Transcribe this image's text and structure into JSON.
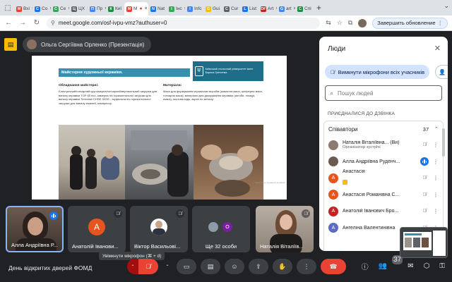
{
  "browser": {
    "tabs": [
      {
        "label": "Вхі",
        "fav_color": "#ea4335",
        "fav_text": "M"
      },
      {
        "label": "Co",
        "fav_color": "#1a73e8",
        "fav_text": "C"
      },
      {
        "label": "Се",
        "fav_color": "#34a853",
        "fav_text": "С"
      },
      {
        "label": "ЦХ",
        "fav_color": "#5f6368",
        "fav_text": "Ц"
      },
      {
        "label": "Пр",
        "fav_color": "#4285f4",
        "fav_text": "П"
      },
      {
        "label": "Киї",
        "fav_color": "#1e8e3e",
        "fav_text": "К"
      },
      {
        "label": "М",
        "fav_color": "#ea4335",
        "fav_text": "M",
        "active": true
      },
      {
        "label": "Nat",
        "fav_color": "#1a73e8",
        "fav_text": "N"
      },
      {
        "label": "Інс",
        "fav_color": "#34a853",
        "fav_text": "І"
      },
      {
        "label": "Infc",
        "fav_color": "#4285f4",
        "fav_text": "I"
      },
      {
        "label": "Gui",
        "fav_color": "#fbbc04",
        "fav_text": "G"
      },
      {
        "label": "Cur",
        "fav_color": "#5f6368",
        "fav_text": "C"
      },
      {
        "label": "List",
        "fav_color": "#1a73e8",
        "fav_text": "L"
      },
      {
        "label": "Art",
        "fav_color": "#c5221f",
        "fav_text": "DF"
      },
      {
        "label": "art",
        "fav_color": "#4285f4",
        "fav_text": "G"
      },
      {
        "label": "Спі",
        "fav_color": "#1e8e3e",
        "fav_text": "С"
      }
    ],
    "url": "meet.google.com/osf-ivpu-vmz?authuser=0",
    "update_label": "Завершить обновление"
  },
  "presenter": {
    "label": "Ольга Сергіївна Орленко (Презентація)"
  },
  "slide": {
    "title": "Майстерня художньої кераміки.",
    "university": "Київський столичний університет імені Бориса Грінченка",
    "col1_heading": "Обладнання майстерні:",
    "col1_text": "Електричний/гончарний круг,кімерна/гончарний/вертикальний загрузки для випалу кераміки TOP 60 eco, камерна піч горизонтальної загрузки для випалу кераміки Termolab СНОЛ 30/30 – муфельна піч горизонтальної загрузки для випалу емалей, компресор.",
    "col2_heading": "Матеріали:",
    "col2_text": "Маси для формування керамічних виробів (шамотна маса, шліферна маса, гончарна маса); матеріали для декорування кераміки (ангоби, глазурі, емалі), листова мідь, акрил по металу.",
    "caption": "Майстерня художньої кераміки"
  },
  "tiles": [
    {
      "name": "Алла Андріївна Р...",
      "initial": "",
      "speaking": true
    },
    {
      "name": "Анатолій Іванови...",
      "initial": "А",
      "color": "#e8541e"
    },
    {
      "name": "Віктор Васильові...",
      "initial": "",
      "color": "#ffffff"
    },
    {
      "name": "Ще 32 особи",
      "initial": "О",
      "color": "#7b1fa2"
    },
    {
      "name": "Наталія Віталіїв...",
      "initial": ""
    }
  ],
  "meeting": {
    "title": "День відкритих дверей ФОМД",
    "mic_tooltip": "Увімкнути мікрофон (⌘ + d)",
    "people_count": "37"
  },
  "panel": {
    "title": "Люди",
    "mute_all_label": "Вимкнути мікрофони всіх учасників",
    "search_placeholder": "Пошук людей",
    "joined_label": "ПРИЄДНАЛИСЯ ДО ДЗВІНКА",
    "group_label": "Співавтори",
    "group_count": "37",
    "people": [
      {
        "name": "Наталія Віталіївна... (Ви)",
        "role": "Організатор зустрічі",
        "color": "#8a7a70",
        "initial": "",
        "mic": "muted"
      },
      {
        "name": "Алла Андріївна Руденч...",
        "role": "",
        "color": "#6b5a50",
        "initial": "",
        "mic": "active"
      },
      {
        "name": "Анастасія",
        "role": "",
        "color": "#e8541e",
        "initial": "А",
        "mic": "muted",
        "hand": true
      },
      {
        "name": "Анастасія Романівна С...",
        "role": "",
        "color": "#e8541e",
        "initial": "А",
        "mic": "muted"
      },
      {
        "name": "Анатолій Іванович Бро...",
        "role": "",
        "color": "#c5221f",
        "initial": "А",
        "mic": "muted"
      },
      {
        "name": "Ангеліна Валентинівна",
        "role": "",
        "color": "#5c6bc0",
        "initial": "А",
        "mic": "muted"
      }
    ]
  }
}
